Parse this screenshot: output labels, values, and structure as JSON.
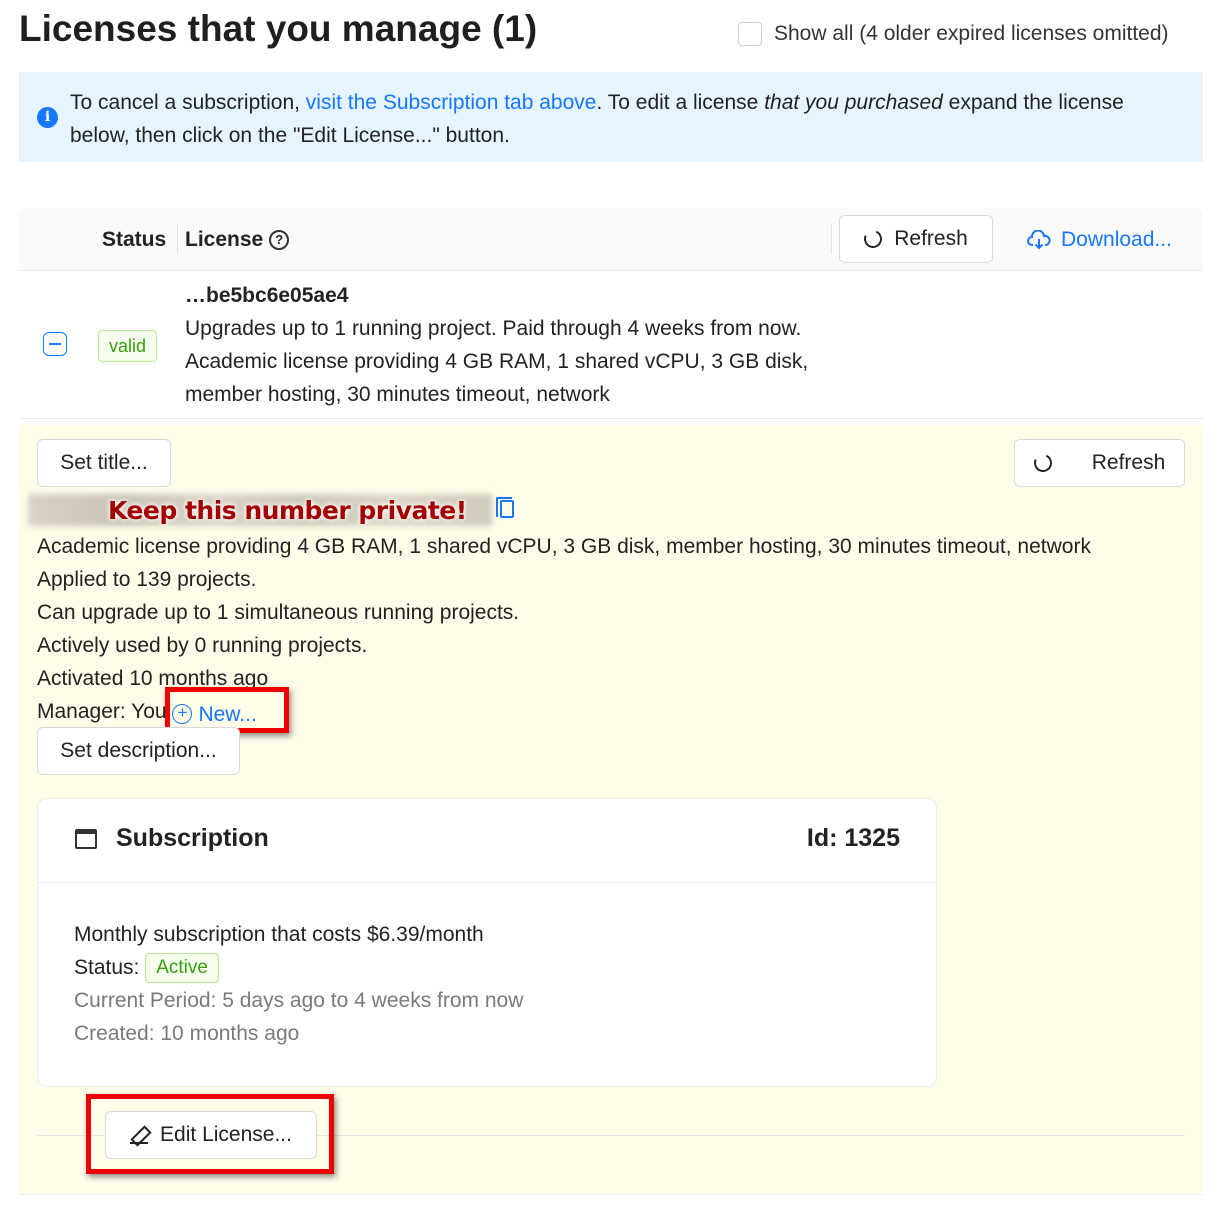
{
  "header": {
    "title": "Licenses that you manage (1)",
    "show_all_label": "Show all (4 older expired licenses omitted)"
  },
  "alert": {
    "text_before": "To cancel a subscription, ",
    "link": "visit the Subscription tab above",
    "text_middle": ". To edit a license ",
    "emphasis": "that you purchased",
    "text_after": " expand the license below, then click on the \"Edit License...\" button."
  },
  "table": {
    "col_status": "Status",
    "col_license": "License",
    "help_glyph": "?",
    "refresh_label": "Refresh",
    "download_label": "Download..."
  },
  "license_row": {
    "status": "valid",
    "key": "…be5bc6e05ae4",
    "line1": "Upgrades up to 1 running project. Paid through 4 weeks from now.",
    "line2": "Academic license providing 4 GB RAM, 1 shared vCPU, 3 GB disk, member hosting, 30 minutes timeout, network"
  },
  "expanded": {
    "set_title_label": "Set title...",
    "refresh_label": "Refresh",
    "private_warning": "Keep this number private!",
    "description": "Academic license providing 4 GB RAM, 1 shared vCPU, 3 GB disk, member hosting, 30 minutes timeout, network",
    "applied": "Applied to 139 projects.",
    "can_upgrade": "Can upgrade up to 1 simultaneous running projects.",
    "active_use": "Actively used by 0 running projects.",
    "activated": "Activated 10 months ago",
    "manager_label": "Manager: You",
    "new_label": "New...",
    "set_description_label": "Set description...",
    "edit_license_label": "Edit License..."
  },
  "subscription": {
    "title": "Subscription",
    "id_label": "Id: 1325",
    "cost": "Monthly subscription that costs $6.39/month",
    "status_label": "Status:",
    "status_value": "Active",
    "period": "Current Period: 5 days ago to 4 weeks from now",
    "created": "Created: 10 months ago"
  },
  "colors": {
    "accent": "#1677ff",
    "alert_bg": "#e6f4ff",
    "expanded_bg": "#fffbe6",
    "success": "#389e0d",
    "highlight": "#ee0000",
    "warning_text": "#a30000"
  }
}
